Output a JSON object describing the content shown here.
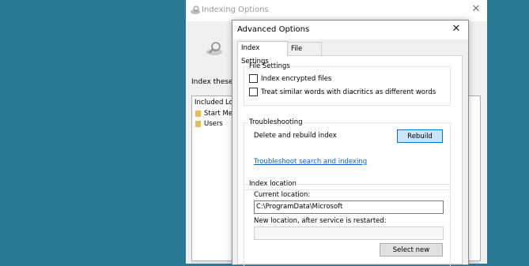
{
  "bg_window": {
    "title": "Indexing Options",
    "close_glyph": "✕",
    "index_label": "Index these lo",
    "list_header": "Included Loca",
    "list_items": [
      "Start Men",
      "Users"
    ]
  },
  "dialog": {
    "title": "Advanced Options",
    "close_glyph": "✕",
    "tabs": [
      "Index Settings",
      "File Types"
    ],
    "file_settings": {
      "title": "File Settings",
      "options": [
        "Index encrypted files",
        "Treat similar words with diacritics as different words"
      ]
    },
    "troubleshooting": {
      "title": "Troubleshooting",
      "rebuild_label": "Delete and rebuild index",
      "rebuild_button": "Rebuild",
      "link": "Troubleshoot search and indexing"
    },
    "index_location": {
      "title": "Index location",
      "current_label": "Current location:",
      "current_value": "C:\\ProgramData\\Microsoft",
      "new_label": "New location, after service is restarted:",
      "new_value": "",
      "select_button": "Select new"
    }
  },
  "colors": {
    "desktop": "#2b7a93",
    "link": "#0066cc",
    "default_button": "#cce4f7"
  },
  "icons": [
    "indexing-options-icon",
    "close-icon",
    "folder-icon"
  ]
}
